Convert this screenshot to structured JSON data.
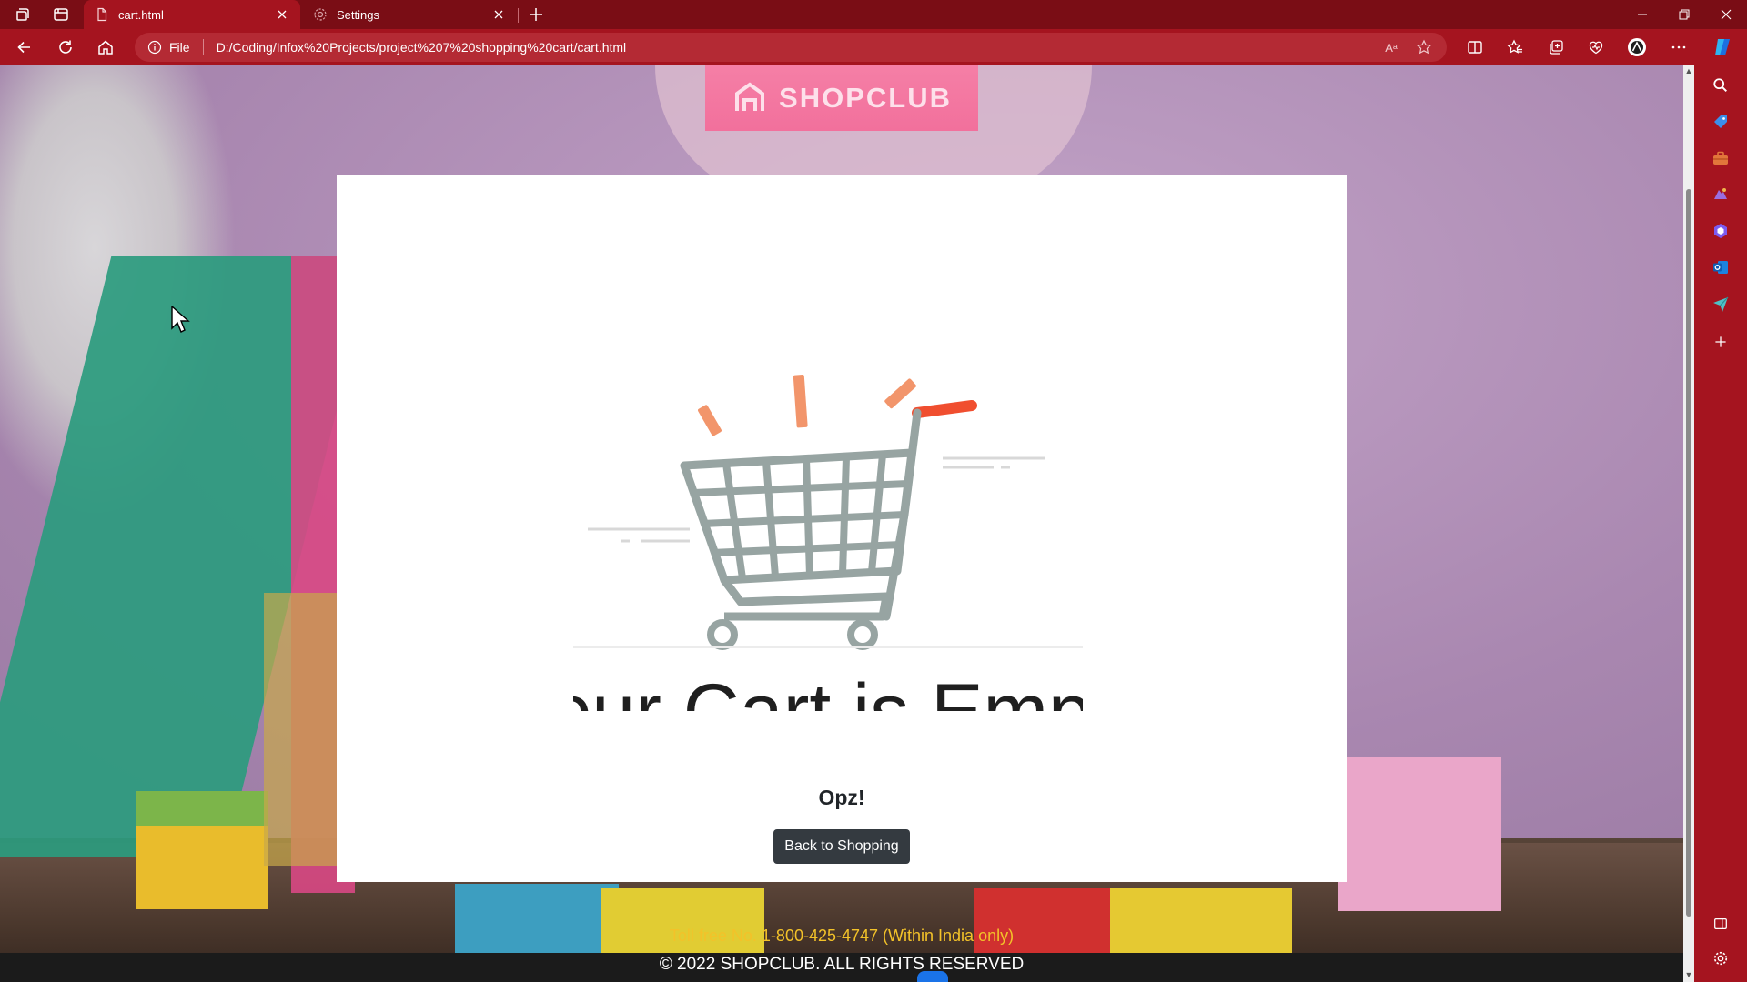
{
  "browser": {
    "tabs": [
      {
        "title": "cart.html",
        "active": true
      },
      {
        "title": "Settings",
        "active": false
      }
    ],
    "address": {
      "protocol_label": "File",
      "url": "D:/Coding/Infox%20Projects/project%207%20shopping%20cart/cart.html"
    },
    "read_aloud_label": "Aᵃ"
  },
  "page": {
    "brand": "SHOPCLUB",
    "heading": "Your Cart is Empty",
    "subheading": "Opz!",
    "back_button": "Back to Shopping",
    "toll_free": "Toll free No. 1-800-425-4747 (Within India only)",
    "copyright": "© 2022 SHOPCLUB. ALL RIGHTS RESERVED"
  },
  "colors": {
    "browser_frame": "#a5141f",
    "tab_strip": "#7a0d15",
    "logo_pink": "#f2709c",
    "cart_gray": "#97a4a2",
    "cart_accent": "#f04e2f",
    "button_dark": "#343a40",
    "toll_free_yellow": "#f3c229",
    "footer_dark": "#1b1b1b"
  },
  "icons": [
    "workspaces-icon",
    "tab-actions-icon",
    "page-icon",
    "settings-icon",
    "close-icon",
    "plus-icon",
    "back-icon",
    "refresh-icon",
    "home-icon",
    "info-icon",
    "read-aloud-icon",
    "favorite-star-icon",
    "split-screen-icon",
    "favorites-icon",
    "collections-icon",
    "extensions-icon",
    "profile-icon",
    "more-icon",
    "copilot-icon",
    "search-icon",
    "shopping-tag-icon",
    "tools-icon",
    "games-icon",
    "office-icon",
    "outlook-icon",
    "send-icon",
    "add-icon",
    "sidebar-toggle-icon",
    "gear-icon",
    "cursor-icon",
    "shopping-cart-icon"
  ]
}
